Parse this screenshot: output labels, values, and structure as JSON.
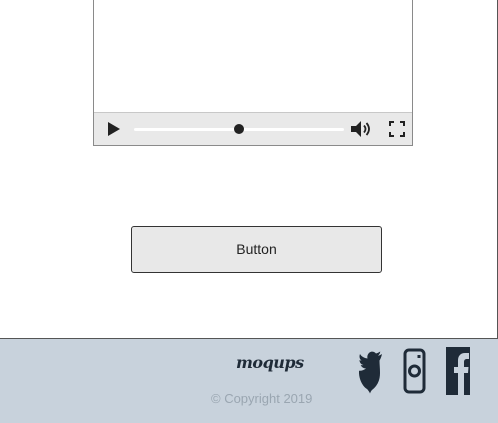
{
  "button": {
    "label": "Button"
  },
  "video": {
    "progress": 0.5
  },
  "footer": {
    "brand": "moqups",
    "copyright": "© Copyright 2019",
    "social": [
      "twitter-icon",
      "instagram-icon",
      "facebook-icon"
    ]
  },
  "colors": {
    "footer_bg": "#c8d2dc",
    "controls_bg": "#e9e9e9",
    "button_bg": "#e8e8e8",
    "icon": "#1f2b38"
  }
}
